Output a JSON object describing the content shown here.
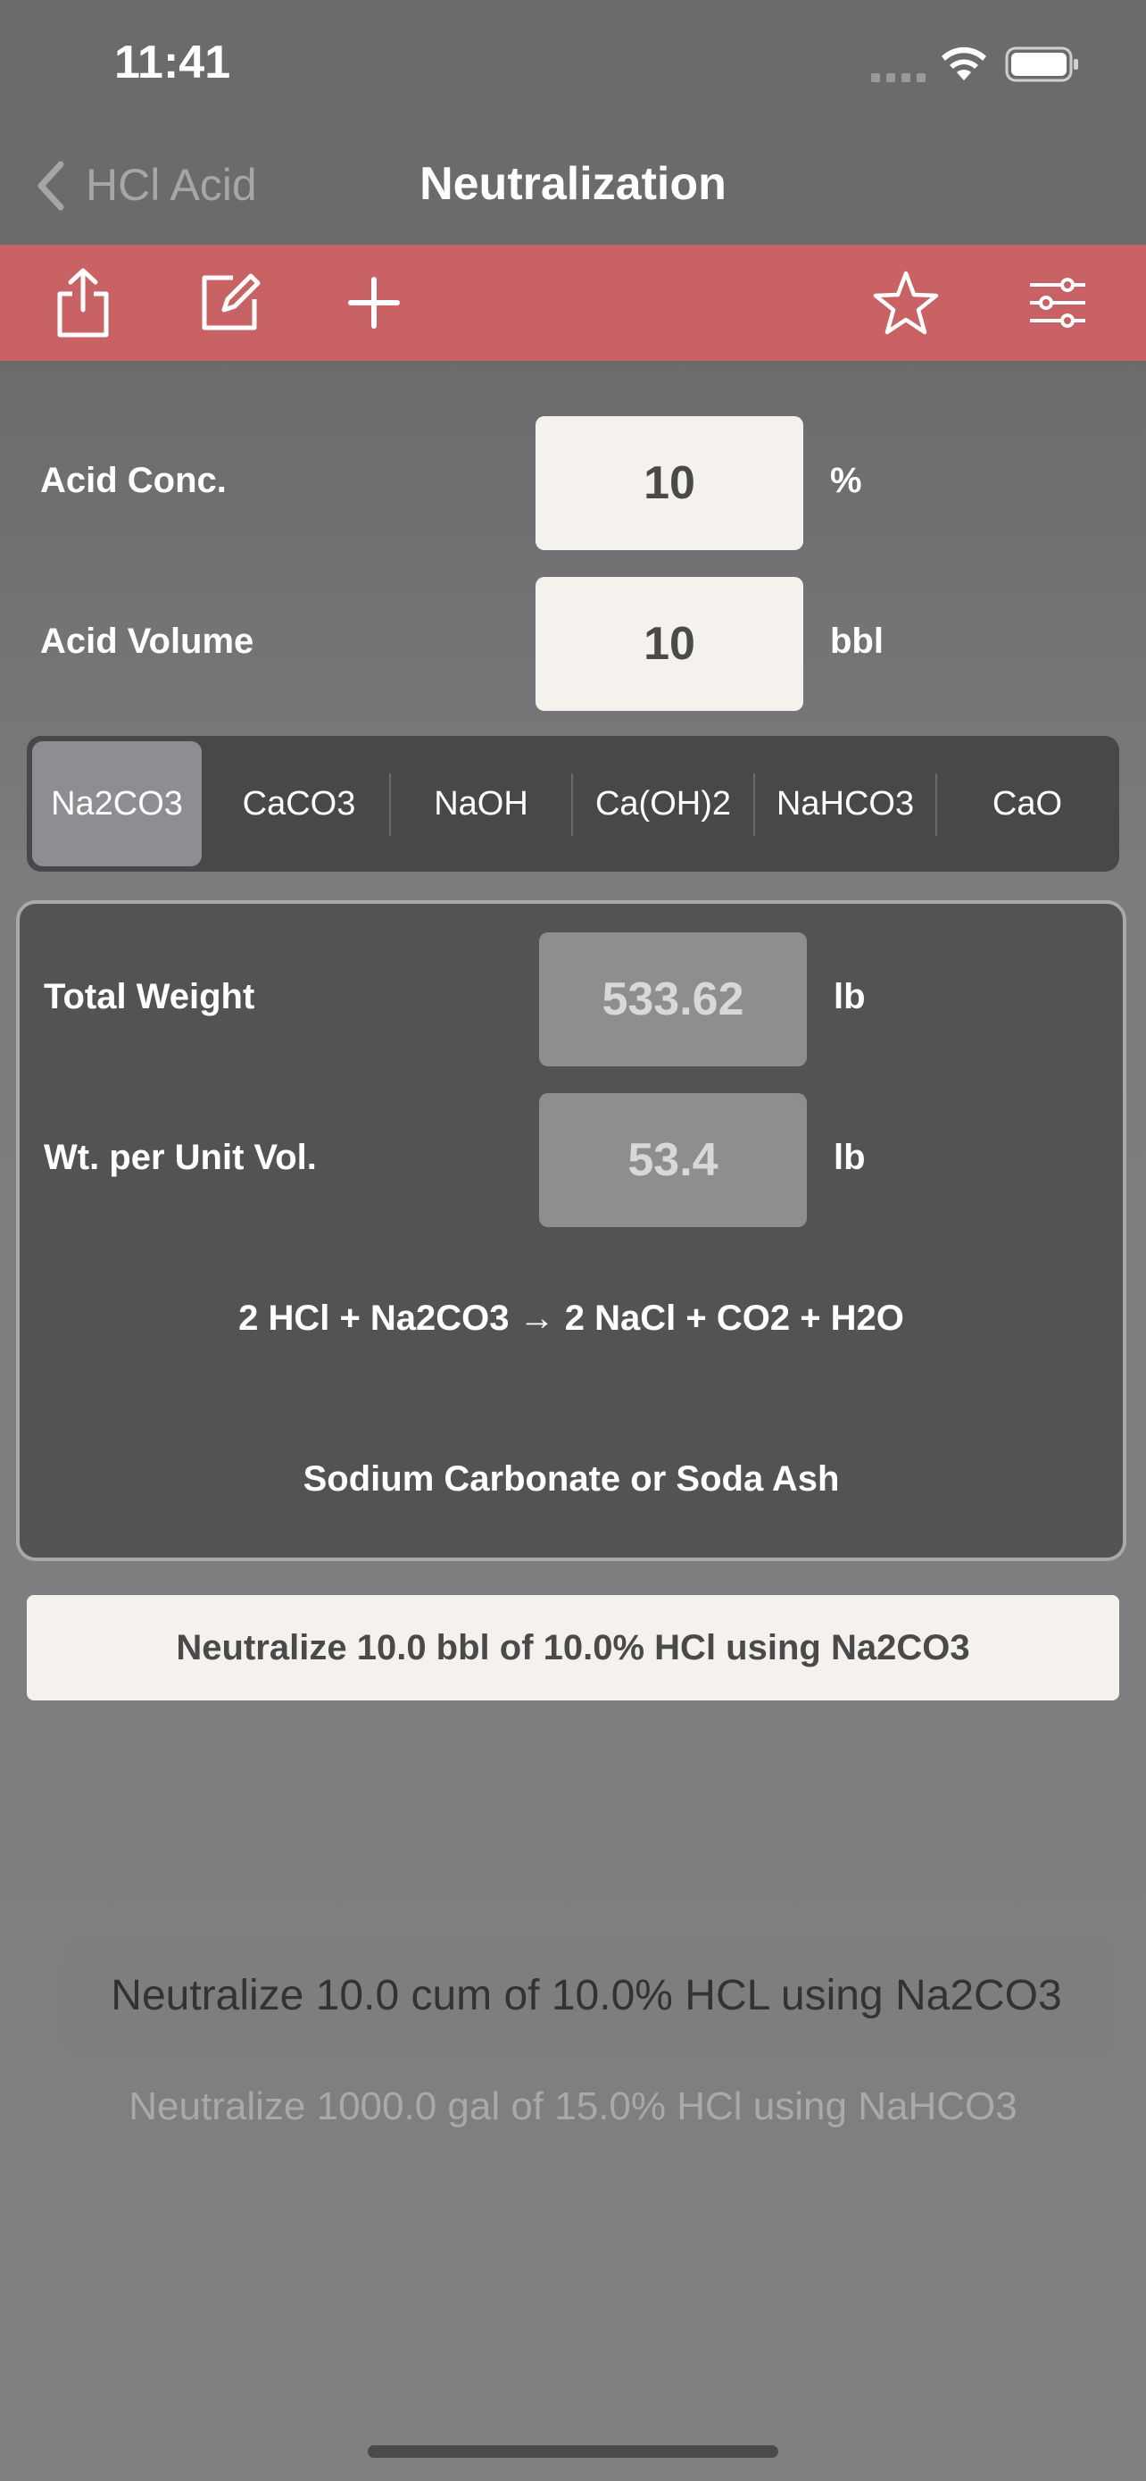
{
  "status": {
    "time": "11:41"
  },
  "nav": {
    "back_label": "HCl Acid",
    "title": "Neutralization"
  },
  "toolbar": {
    "icons": [
      "share-icon",
      "edit-icon",
      "plus-icon",
      "star-icon",
      "sliders-icon"
    ]
  },
  "inputs": {
    "acid_conc": {
      "label": "Acid Conc.",
      "value": "10",
      "unit": "%"
    },
    "acid_volume": {
      "label": "Acid Volume",
      "value": "10",
      "unit": "bbl"
    }
  },
  "segments": {
    "options": [
      "Na2CO3",
      "CaCO3",
      "NaOH",
      "Ca(OH)2",
      "NaHCO3",
      "CaO"
    ],
    "selected": "Na2CO3"
  },
  "results": {
    "total_weight": {
      "label": "Total Weight",
      "value": "533.62",
      "unit": "lb"
    },
    "wt_per_unit_vol": {
      "label": "Wt. per Unit Vol.",
      "value": "53.4",
      "unit": "lb"
    },
    "equation": "2 HCl + Na2CO3 → 2 NaCl + CO2 + H2O",
    "compound_name": "Sodium Carbonate or Soda Ash"
  },
  "summary": "Neutralize 10.0 bbl of 10.0% HCl using Na2CO3",
  "suggestions": {
    "primary": "Neutralize 10.0 cum of 10.0% HCL using Na2CO3",
    "secondary": "Neutralize 1000.0 gal of 15.0% HCl using NaHCO3"
  }
}
